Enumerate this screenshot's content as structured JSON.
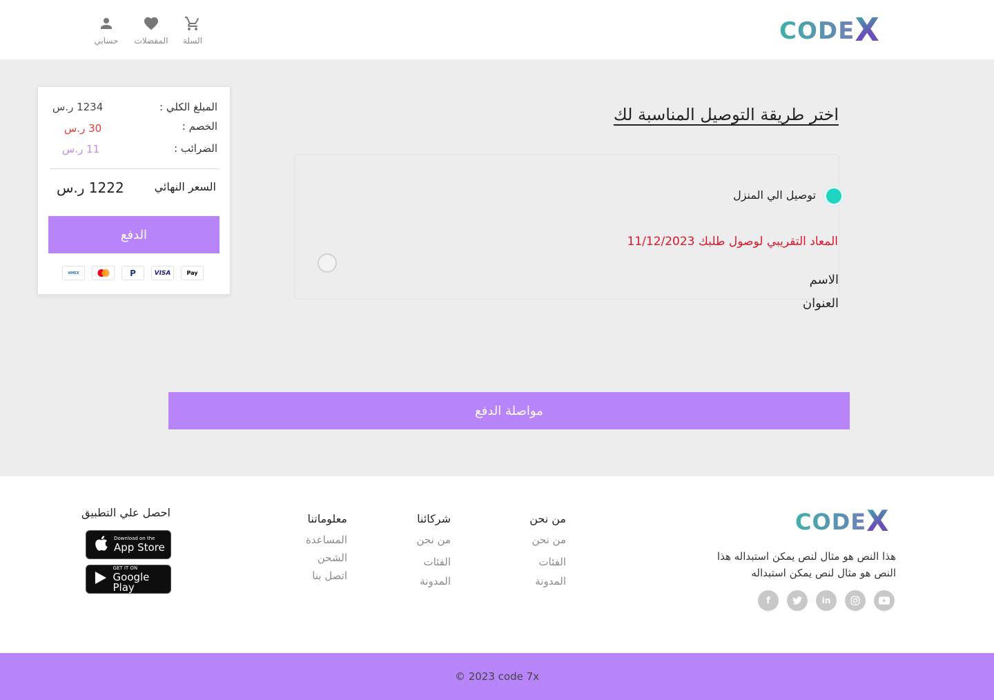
{
  "header": {
    "logo": {
      "code": "CODE",
      "x": "X"
    },
    "nav": [
      {
        "name": "cart",
        "icon": "cart-icon",
        "glyph": "🛒",
        "label": "السلة"
      },
      {
        "name": "favorites",
        "icon": "heart-icon",
        "glyph": "♥",
        "label": "المفضلات"
      },
      {
        "name": "account",
        "icon": "user-icon",
        "glyph": "👤",
        "label": "حسابي"
      }
    ]
  },
  "main": {
    "title": "اختر طريقة التوصيل المناسبة لك",
    "home_delivery_label": "توصيل الي المنزل",
    "eta_text": "المعاد التقريبي لوصول طلبك 11/12/2023",
    "name_label": "الاسم",
    "address_label": "العنوان",
    "continue_button": "مواصلة الدفع"
  },
  "summary": {
    "total_label": "المبلغ الكلي :",
    "total_value": "1234 ر.س",
    "discount_label": "الخصم :",
    "discount_value": "30 ر.س",
    "tax_label": "الضرائب :",
    "tax_value": "11 ر.س",
    "final_label": "السعر النهائي",
    "final_value": "1222 ر.س",
    "pay_button": "الدفع",
    "payment_methods": [
      "Apple Pay",
      "VISA",
      "PayPal",
      "Mastercard",
      "American Express"
    ]
  },
  "footer": {
    "logo": {
      "code": "CODE",
      "x": "X"
    },
    "description": "هذا النص هو مثال لنص يمكن استبداله هذا النص هو مثال لنص يمكن استبداله",
    "socials": [
      "youtube-icon",
      "instagram-icon",
      "linkedin-icon",
      "twitter-icon",
      "facebook-icon"
    ],
    "columns": [
      {
        "title": "من نحن",
        "links": [
          "من نحن",
          "الفئات",
          "المدونة"
        ]
      },
      {
        "title": "شركائنا",
        "links": [
          "من نحن",
          "الفئات",
          "المدونة"
        ]
      },
      {
        "title": "معلوماتنا",
        "links": [
          "المساعدة",
          "الشحن",
          "اتصل بنا"
        ]
      }
    ],
    "app_title": "احصل علي التطبيق",
    "app_store": {
      "small": "Download on the",
      "big": "App Store"
    },
    "google_play": {
      "small": "GET IT ON",
      "big": "Google Play"
    },
    "copyright": "© 2023 code 7x"
  },
  "colors": {
    "accent": "#b784fa",
    "radio_selected": "#1fd4c0",
    "eta_red": "#e0152b",
    "discount_red": "#e53935",
    "tax_purple": "#c08cf0"
  }
}
